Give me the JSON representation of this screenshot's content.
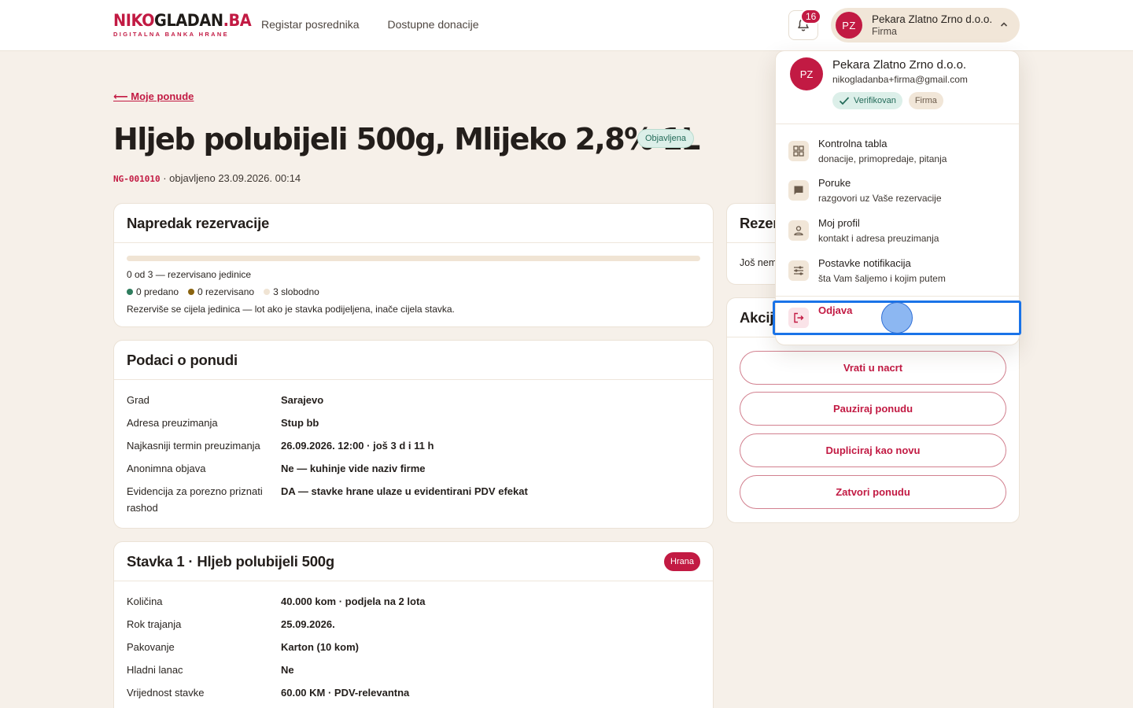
{
  "brand": {
    "name_red": "NIKO",
    "name_dark": "GLADAN",
    "name_tld": ".BA",
    "tagline": "DIGITALNA BANKA HRANE",
    "accent": "#c21a43"
  },
  "nav": {
    "items": [
      "Registar posrednika",
      "Dostupne donacije"
    ]
  },
  "notifications": {
    "count": "16",
    "icon": "bell-icon"
  },
  "account": {
    "initials": "PZ",
    "name": "Pekara Zlatno Zrno d.o.o.",
    "role": "Firma"
  },
  "page": {
    "back_link": "⟵ Moje ponude",
    "title": "Hljeb polubijeli 500g, Mlijeko 2,8% 1L",
    "status": "Objavljena",
    "code": "NG-001010",
    "published": "· objavljeno 23.09.2026. 00:14"
  },
  "progress_card": {
    "title": "Napredak rezervacije",
    "progress_fraction": 0,
    "summary": "0 od 3 — rezervisano jedinice",
    "legend": [
      {
        "label": "0 predano",
        "color": "#2f7d5e"
      },
      {
        "label": "0 rezervisano",
        "color": "#8a6410"
      },
      {
        "label": "3 slobodno",
        "color": "#f0e4d4"
      }
    ],
    "note": "Rezerviše se cijela jedinica — lot ako je stavka podijeljena, inače cijela stavka."
  },
  "offer_card": {
    "title": "Podaci o ponudi",
    "rows": [
      {
        "key": "Grad",
        "value": "Sarajevo"
      },
      {
        "key": "Adresa preuzimanja",
        "value": "Stup bb"
      },
      {
        "key": "Najkasniji termin preuzimanja",
        "value": "26.09.2026. 12:00 · još 3 d i 11 h"
      },
      {
        "key": "Anonimna objava",
        "value": "Ne — kuhinje vide naziv firme"
      },
      {
        "key": "Evidencija za porezno priznati rashod",
        "value": "DA — stavke hrane ulaze u evidentirani PDV efekat"
      }
    ]
  },
  "item_card": {
    "title": "Stavka 1 · Hljeb polubijeli 500g",
    "badge": "Hrana",
    "rows": [
      {
        "key": "Količina",
        "value": "40.000 kom · podjela na 2 lota"
      },
      {
        "key": "Rok trajanja",
        "value": "25.09.2026."
      },
      {
        "key": "Pakovanje",
        "value": "Karton (10 kom)"
      },
      {
        "key": "Hladni lanac",
        "value": "Ne"
      },
      {
        "key": "Vrijednost stavke",
        "value": "60.00 KM · PDV-relevantna"
      }
    ]
  },
  "reservations_card": {
    "title_visible": "Rezer",
    "body_visible": "Još nem"
  },
  "actions_card": {
    "title_visible": "Akcij",
    "buttons": [
      "Vrati u nacrt",
      "Pauziraj ponudu",
      "Dupliciraj kao novu",
      "Zatvori ponudu"
    ]
  },
  "dropdown": {
    "initials": "PZ",
    "name": "Pekara Zlatno Zrno d.o.o.",
    "email": "nikogladanba+firma@gmail.com",
    "verified": "Verifikovan",
    "type": "Firma",
    "items": [
      {
        "label": "Kontrolna tabla",
        "sub": "donacije, primopredaje, pitanja",
        "icon": "dashboard-icon"
      },
      {
        "label": "Poruke",
        "sub": "razgovori uz Vaše rezervacije",
        "icon": "chat-icon"
      },
      {
        "label": "Moj profil",
        "sub": "kontakt i adresa preuzimanja",
        "icon": "user-icon"
      },
      {
        "label": "Postavke notifikacija",
        "sub": "šta Vam šaljemo i kojim putem",
        "icon": "sliders-icon"
      }
    ],
    "logout": {
      "label": "Odjava",
      "icon": "logout-icon"
    }
  }
}
